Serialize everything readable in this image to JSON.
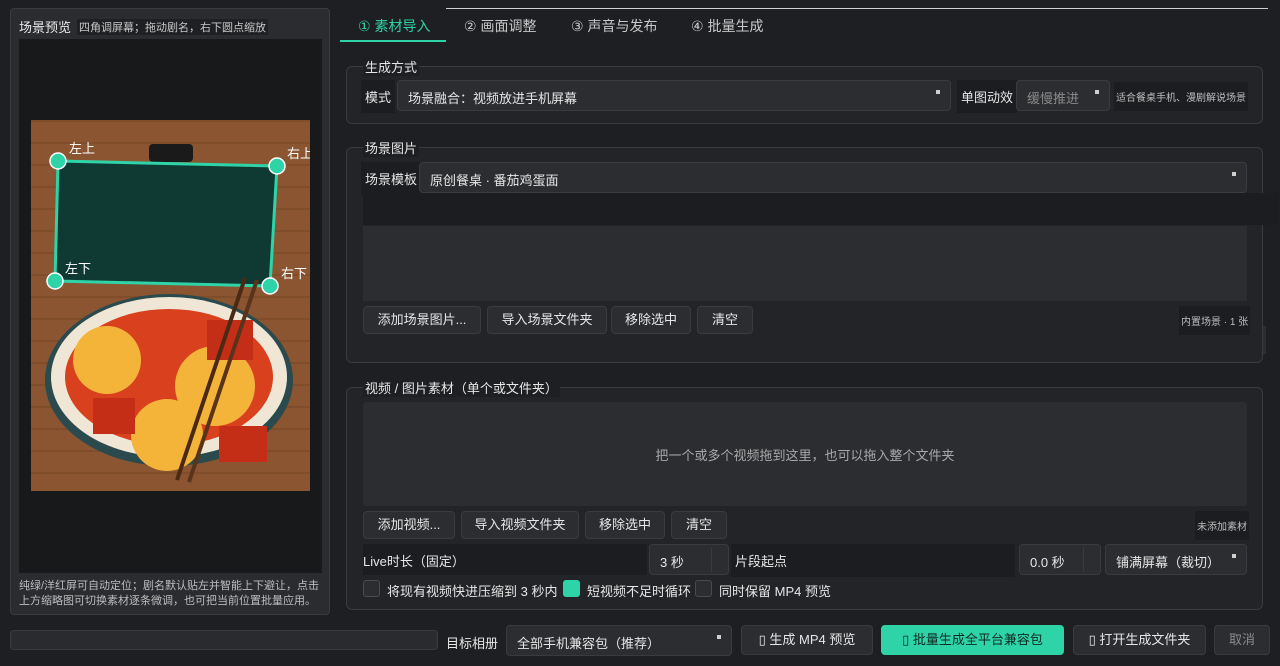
{
  "preview": {
    "title": "场景预览",
    "hint": "四角调屏幕；拖动剧名，右下圆点缩放",
    "corners": {
      "tl": "左上",
      "tr": "右上",
      "bl": "左下",
      "br": "右下"
    },
    "footer": "纯绿/洋红屏可自动定位；剧名默认贴左并智能上下避让，点击上方缩略图可切换素材逐条微调，也可把当前位置批量应用。"
  },
  "tabs": [
    "① 素材导入",
    "② 画面调整",
    "③ 声音与发布",
    "④ 批量生成"
  ],
  "gen_mode": {
    "title": "生成方式",
    "mode_label": "模式",
    "mode_value": "场景融合：视频放进手机屏幕",
    "anim_label": "单图动效",
    "anim_value": "缓慢推进",
    "anim_hint": "适合餐桌手机、漫剧解说场景"
  },
  "scene_images": {
    "title": "场景图片",
    "template_label": "场景模板",
    "template_value": "原创餐桌 · 番茄鸡蛋面",
    "buttons": [
      "添加场景图片...",
      "导入场景文件夹",
      "移除选中",
      "清空"
    ],
    "status": "内置场景 · 1 张"
  },
  "materials": {
    "title": "视频 / 图片素材（单个或文件夹）",
    "drop_hint": "把一个或多个视频拖到这里，也可以拖入整个文件夹",
    "buttons": [
      "添加视频...",
      "导入视频文件夹",
      "移除选中",
      "清空"
    ],
    "status": "未添加素材",
    "live_label": "Live时长（固定）",
    "live_value": "3 秒",
    "start_label": "片段起点",
    "start_value": "0.0 秒",
    "fill_value": "铺满屏幕（裁切）",
    "options": [
      {
        "label": "将现有视频快进压缩到 3 秒内",
        "checked": false
      },
      {
        "label": "短视频不足时循环",
        "checked": true
      },
      {
        "label": "同时保留 MP4 预览",
        "checked": false
      }
    ]
  },
  "bottom": {
    "album_label": "目标相册",
    "album_value": "全部手机兼容包（推荐）",
    "btn_mp4": "▯ 生成 MP4 预览",
    "btn_batch": "▯ 批量生成全平台兼容包",
    "btn_open": "▯ 打开生成文件夹",
    "btn_cancel": "取消"
  },
  "colors": {
    "accent": "#2fd3a8",
    "screen": "#0f3a34",
    "tomato": "#d8401e"
  }
}
